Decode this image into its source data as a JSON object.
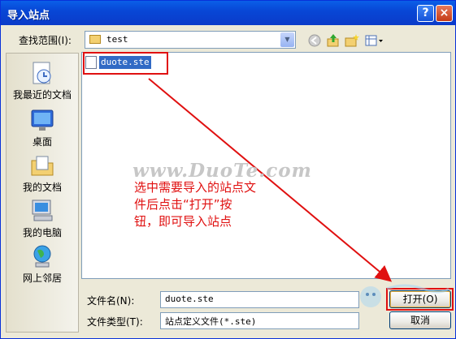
{
  "window": {
    "title": "导入站点",
    "help_glyph": "?",
    "close_glyph": "×"
  },
  "lookin": {
    "label": "查找范围(I):",
    "value": "test"
  },
  "toolbar": {
    "back_icon": "back-icon",
    "up_icon": "up-folder-icon",
    "new_folder_icon": "new-folder-icon",
    "view_icon": "view-menu-icon"
  },
  "places": [
    {
      "label": "我最近的文档",
      "icon": "recent-documents-icon"
    },
    {
      "label": "桌面",
      "icon": "desktop-icon"
    },
    {
      "label": "我的文档",
      "icon": "my-documents-icon"
    },
    {
      "label": "我的电脑",
      "icon": "my-computer-icon"
    },
    {
      "label": "网上邻居",
      "icon": "network-places-icon"
    }
  ],
  "files": [
    {
      "name": "duote.ste"
    }
  ],
  "annotation": {
    "line1": "选中需要导入的站点文",
    "line2": "件后点击“打开”按",
    "line3": "钮，即可导入站点"
  },
  "watermark": {
    "text": "www.DuoTe.com"
  },
  "filename": {
    "label": "文件名(N):",
    "value": "duote.ste"
  },
  "filetype": {
    "label": "文件类型(T):",
    "value": "站点定义文件(*.ste)"
  },
  "buttons": {
    "open": "打开(O)",
    "cancel": "取消"
  },
  "colors": {
    "title_bar": "#0a5fe8",
    "selection": "#316ac5",
    "annotation": "#e01010"
  }
}
